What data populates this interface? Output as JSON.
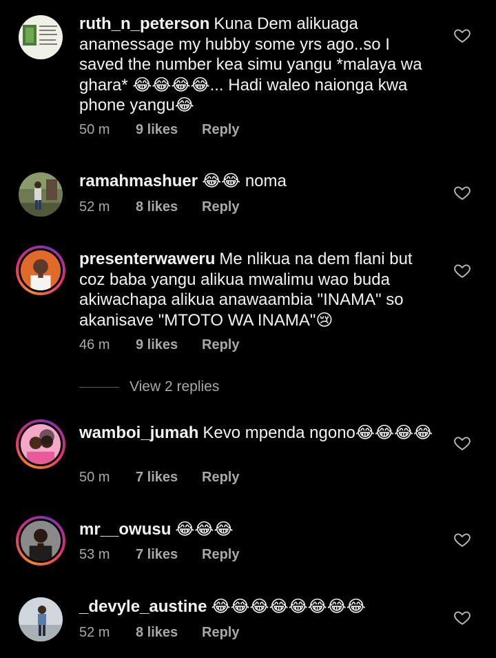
{
  "comments": [
    {
      "username": "ruth_n_peterson",
      "text": "Kuna Dem alikuaga anamessage my hubby some yrs ago..so I saved the number kea simu yangu *malaya wa ghara* 😂😂😂😂... Hadi waleo naionga kwa phone yangu😂",
      "time": "50 m",
      "likes": "9 likes",
      "reply": "Reply"
    },
    {
      "username": "ramahmashuer",
      "text": "😂😂 noma",
      "time": "52 m",
      "likes": "8 likes",
      "reply": "Reply"
    },
    {
      "username": "presenterwaweru",
      "text": "Me nlikua na dem flani but coz baba yangu alikua mwalimu wao buda akiwachapa alikua anawaambia \"INAMA\" so akanisave \"MTOTO WA INAMA\"😢",
      "time": "46 m",
      "likes": "9 likes",
      "reply": "Reply"
    },
    {
      "username": "wamboi_jumah",
      "text": "Kevo mpenda ngono😂😂😂😂",
      "time": "50 m",
      "likes": "7 likes",
      "reply": "Reply"
    },
    {
      "username": "mr__owusu",
      "text": "😂😂😂",
      "time": "53 m",
      "likes": "7 likes",
      "reply": "Reply"
    },
    {
      "username": "_devyle_austine",
      "text": "😂😂😂😂😂😂😂😂",
      "time": "52 m",
      "likes": "8 likes",
      "reply": "Reply"
    }
  ],
  "view_replies": "View 2 replies",
  "icons": {
    "like": "heart-outline-icon"
  },
  "colors": {
    "background": "#000000",
    "meta": "#a8a8a8",
    "text": "#f2f2f2"
  }
}
